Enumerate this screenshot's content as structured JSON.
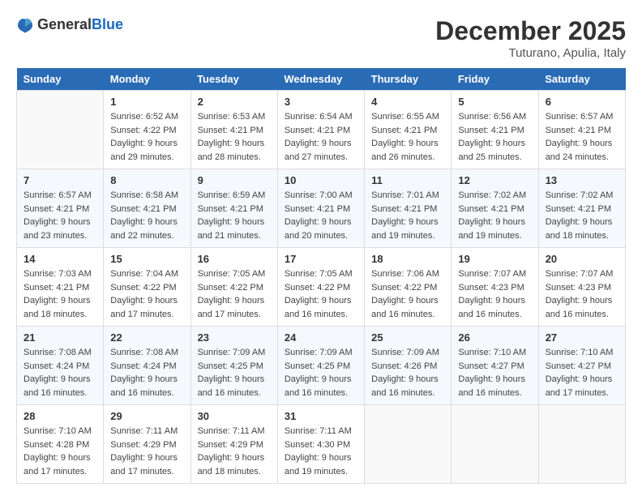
{
  "header": {
    "logo_general": "General",
    "logo_blue": "Blue",
    "month_title": "December 2025",
    "location": "Tuturano, Apulia, Italy"
  },
  "days_of_week": [
    "Sunday",
    "Monday",
    "Tuesday",
    "Wednesday",
    "Thursday",
    "Friday",
    "Saturday"
  ],
  "weeks": [
    [
      {
        "day": "",
        "empty": true
      },
      {
        "day": "1",
        "sunrise": "Sunrise: 6:52 AM",
        "sunset": "Sunset: 4:22 PM",
        "daylight": "Daylight: 9 hours and 29 minutes."
      },
      {
        "day": "2",
        "sunrise": "Sunrise: 6:53 AM",
        "sunset": "Sunset: 4:21 PM",
        "daylight": "Daylight: 9 hours and 28 minutes."
      },
      {
        "day": "3",
        "sunrise": "Sunrise: 6:54 AM",
        "sunset": "Sunset: 4:21 PM",
        "daylight": "Daylight: 9 hours and 27 minutes."
      },
      {
        "day": "4",
        "sunrise": "Sunrise: 6:55 AM",
        "sunset": "Sunset: 4:21 PM",
        "daylight": "Daylight: 9 hours and 26 minutes."
      },
      {
        "day": "5",
        "sunrise": "Sunrise: 6:56 AM",
        "sunset": "Sunset: 4:21 PM",
        "daylight": "Daylight: 9 hours and 25 minutes."
      },
      {
        "day": "6",
        "sunrise": "Sunrise: 6:57 AM",
        "sunset": "Sunset: 4:21 PM",
        "daylight": "Daylight: 9 hours and 24 minutes."
      }
    ],
    [
      {
        "day": "7",
        "sunrise": "Sunrise: 6:57 AM",
        "sunset": "Sunset: 4:21 PM",
        "daylight": "Daylight: 9 hours and 23 minutes."
      },
      {
        "day": "8",
        "sunrise": "Sunrise: 6:58 AM",
        "sunset": "Sunset: 4:21 PM",
        "daylight": "Daylight: 9 hours and 22 minutes."
      },
      {
        "day": "9",
        "sunrise": "Sunrise: 6:59 AM",
        "sunset": "Sunset: 4:21 PM",
        "daylight": "Daylight: 9 hours and 21 minutes."
      },
      {
        "day": "10",
        "sunrise": "Sunrise: 7:00 AM",
        "sunset": "Sunset: 4:21 PM",
        "daylight": "Daylight: 9 hours and 20 minutes."
      },
      {
        "day": "11",
        "sunrise": "Sunrise: 7:01 AM",
        "sunset": "Sunset: 4:21 PM",
        "daylight": "Daylight: 9 hours and 19 minutes."
      },
      {
        "day": "12",
        "sunrise": "Sunrise: 7:02 AM",
        "sunset": "Sunset: 4:21 PM",
        "daylight": "Daylight: 9 hours and 19 minutes."
      },
      {
        "day": "13",
        "sunrise": "Sunrise: 7:02 AM",
        "sunset": "Sunset: 4:21 PM",
        "daylight": "Daylight: 9 hours and 18 minutes."
      }
    ],
    [
      {
        "day": "14",
        "sunrise": "Sunrise: 7:03 AM",
        "sunset": "Sunset: 4:21 PM",
        "daylight": "Daylight: 9 hours and 18 minutes."
      },
      {
        "day": "15",
        "sunrise": "Sunrise: 7:04 AM",
        "sunset": "Sunset: 4:22 PM",
        "daylight": "Daylight: 9 hours and 17 minutes."
      },
      {
        "day": "16",
        "sunrise": "Sunrise: 7:05 AM",
        "sunset": "Sunset: 4:22 PM",
        "daylight": "Daylight: 9 hours and 17 minutes."
      },
      {
        "day": "17",
        "sunrise": "Sunrise: 7:05 AM",
        "sunset": "Sunset: 4:22 PM",
        "daylight": "Daylight: 9 hours and 16 minutes."
      },
      {
        "day": "18",
        "sunrise": "Sunrise: 7:06 AM",
        "sunset": "Sunset: 4:22 PM",
        "daylight": "Daylight: 9 hours and 16 minutes."
      },
      {
        "day": "19",
        "sunrise": "Sunrise: 7:07 AM",
        "sunset": "Sunset: 4:23 PM",
        "daylight": "Daylight: 9 hours and 16 minutes."
      },
      {
        "day": "20",
        "sunrise": "Sunrise: 7:07 AM",
        "sunset": "Sunset: 4:23 PM",
        "daylight": "Daylight: 9 hours and 16 minutes."
      }
    ],
    [
      {
        "day": "21",
        "sunrise": "Sunrise: 7:08 AM",
        "sunset": "Sunset: 4:24 PM",
        "daylight": "Daylight: 9 hours and 16 minutes."
      },
      {
        "day": "22",
        "sunrise": "Sunrise: 7:08 AM",
        "sunset": "Sunset: 4:24 PM",
        "daylight": "Daylight: 9 hours and 16 minutes."
      },
      {
        "day": "23",
        "sunrise": "Sunrise: 7:09 AM",
        "sunset": "Sunset: 4:25 PM",
        "daylight": "Daylight: 9 hours and 16 minutes."
      },
      {
        "day": "24",
        "sunrise": "Sunrise: 7:09 AM",
        "sunset": "Sunset: 4:25 PM",
        "daylight": "Daylight: 9 hours and 16 minutes."
      },
      {
        "day": "25",
        "sunrise": "Sunrise: 7:09 AM",
        "sunset": "Sunset: 4:26 PM",
        "daylight": "Daylight: 9 hours and 16 minutes."
      },
      {
        "day": "26",
        "sunrise": "Sunrise: 7:10 AM",
        "sunset": "Sunset: 4:27 PM",
        "daylight": "Daylight: 9 hours and 16 minutes."
      },
      {
        "day": "27",
        "sunrise": "Sunrise: 7:10 AM",
        "sunset": "Sunset: 4:27 PM",
        "daylight": "Daylight: 9 hours and 17 minutes."
      }
    ],
    [
      {
        "day": "28",
        "sunrise": "Sunrise: 7:10 AM",
        "sunset": "Sunset: 4:28 PM",
        "daylight": "Daylight: 9 hours and 17 minutes."
      },
      {
        "day": "29",
        "sunrise": "Sunrise: 7:11 AM",
        "sunset": "Sunset: 4:29 PM",
        "daylight": "Daylight: 9 hours and 17 minutes."
      },
      {
        "day": "30",
        "sunrise": "Sunrise: 7:11 AM",
        "sunset": "Sunset: 4:29 PM",
        "daylight": "Daylight: 9 hours and 18 minutes."
      },
      {
        "day": "31",
        "sunrise": "Sunrise: 7:11 AM",
        "sunset": "Sunset: 4:30 PM",
        "daylight": "Daylight: 9 hours and 19 minutes."
      },
      {
        "day": "",
        "empty": true
      },
      {
        "day": "",
        "empty": true
      },
      {
        "day": "",
        "empty": true
      }
    ]
  ]
}
